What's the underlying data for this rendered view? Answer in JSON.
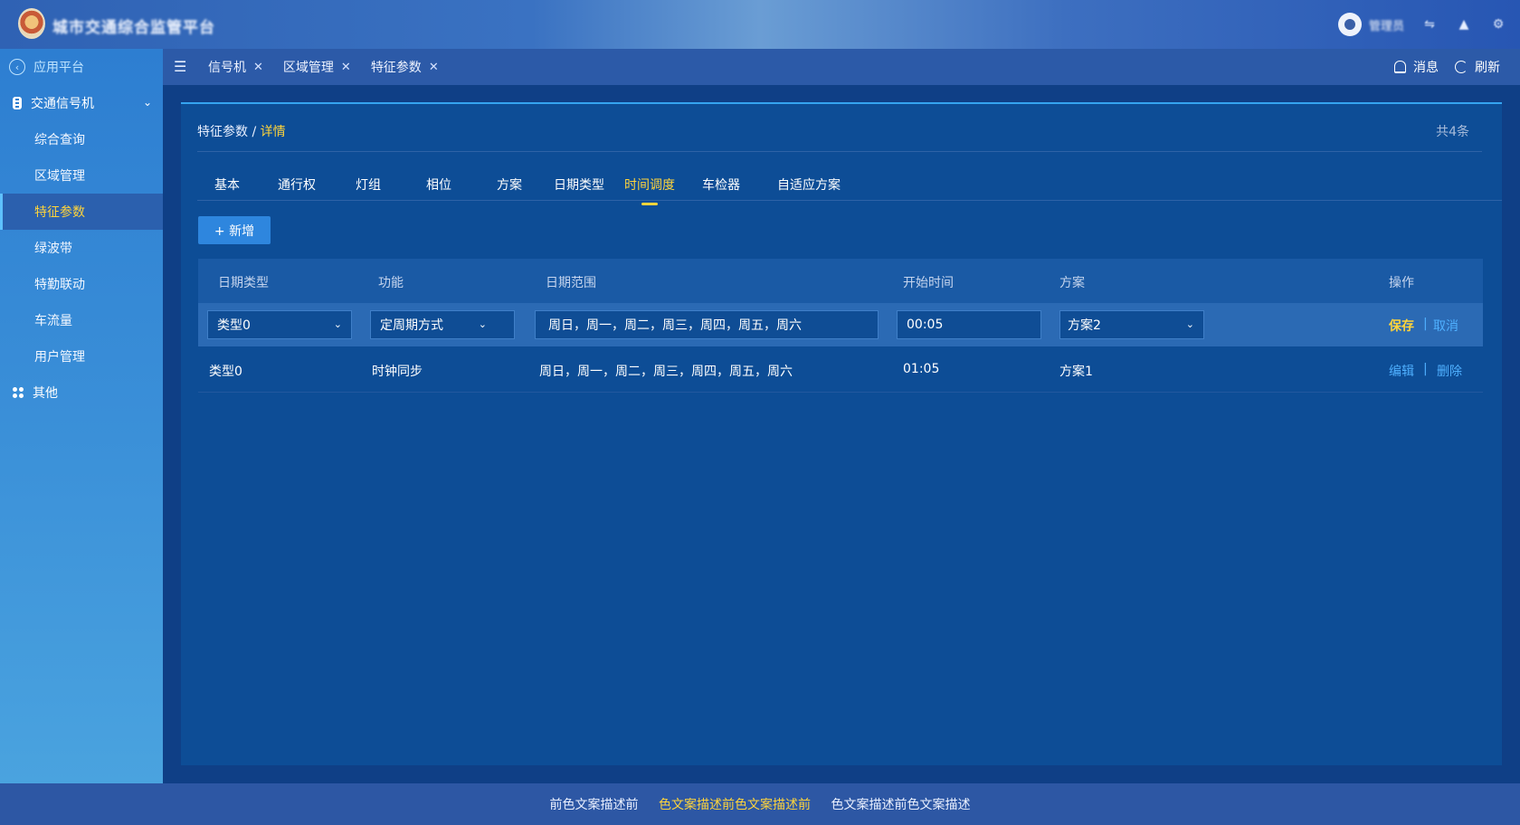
{
  "header": {
    "app_title": "城市交通综合监管平台",
    "user_name": "管理员"
  },
  "sidebar": {
    "back_label": "应用平台",
    "group_label": "交通信号机",
    "items": [
      {
        "label": "综合查询"
      },
      {
        "label": "区域管理"
      },
      {
        "label": "特征参数",
        "active": true
      },
      {
        "label": "绿波带"
      },
      {
        "label": "特勤联动"
      },
      {
        "label": "车流量"
      },
      {
        "label": "用户管理"
      }
    ],
    "other_label": "其他"
  },
  "tabstrip": {
    "tabs": [
      "信号机",
      "区域管理",
      "特征参数"
    ],
    "messages_label": "消息",
    "refresh_label": "刷新"
  },
  "page": {
    "breadcrumb_parent": "特征参数",
    "breadcrumb_sep": "/",
    "breadcrumb_current": "详情",
    "total": "共4条",
    "tabs": [
      "基本",
      "通行权",
      "灯组",
      "相位",
      "方案",
      "日期类型",
      "时间调度",
      "车检器",
      "自适应方案"
    ],
    "active_tab": "时间调度",
    "add_button": "+ 新增"
  },
  "table": {
    "headers": [
      "日期类型",
      "功能",
      "日期范围",
      "开始时间",
      "方案",
      "操作"
    ],
    "edit_row": {
      "date_type": "类型0",
      "function": "定周期方式",
      "date_range": "周日，周一，周二，周三，周四，周五，周六",
      "start_time": "00:05",
      "plan": "方案2",
      "save_label": "保存",
      "sep": "|",
      "cancel_label": "取消"
    },
    "rows": [
      {
        "date_type": "类型0",
        "function": "时钟同步",
        "date_range": "周日，周一，周二，周三，周四，周五，周六",
        "start_time": "01:05",
        "plan": "方案1",
        "edit_label": "编辑",
        "sep": "|",
        "delete_label": "删除"
      }
    ]
  },
  "footer": {
    "links": [
      "前色文案描述前",
      "色文案描述前色文案描述前",
      "色文案描述前色文案描述"
    ],
    "highlight_color": "#ffd43b"
  },
  "colors": {
    "accent": "#ffd43b",
    "link": "#4fb0ff",
    "primary_button": "#2e86de"
  }
}
